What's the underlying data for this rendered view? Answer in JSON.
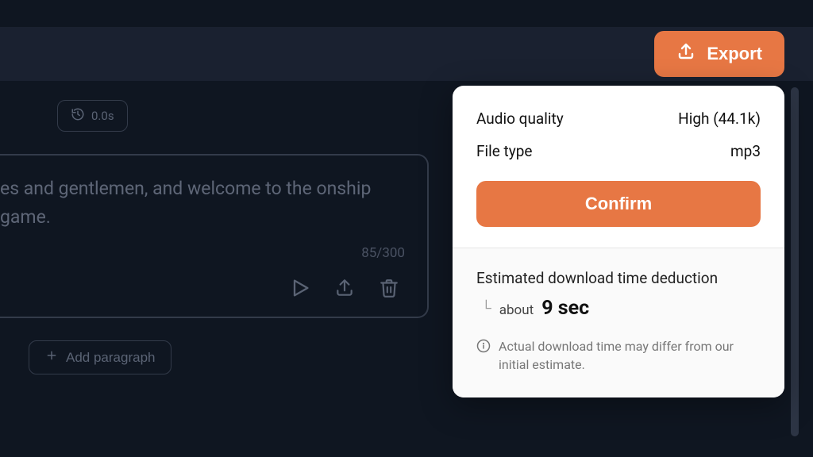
{
  "topbar": {
    "export_label": "Export"
  },
  "time_pill": {
    "value": "0.0s"
  },
  "text_card": {
    "content": "es and gentlemen, and welcome to the onship game.",
    "char_count": "85/300"
  },
  "add_paragraph_label": "Add paragraph",
  "export_popover": {
    "audio_quality_label": "Audio quality",
    "audio_quality_value": "High (44.1k)",
    "file_type_label": "File type",
    "file_type_value": "mp3",
    "confirm_label": "Confirm",
    "estimate_label": "Estimated download time deduction",
    "estimate_about": "about",
    "estimate_value": "9 sec",
    "disclaimer": "Actual download time may differ from our initial estimate."
  },
  "colors": {
    "accent": "#e77744",
    "bg_dark": "#0f1621",
    "panel_dark": "#1a2130"
  }
}
